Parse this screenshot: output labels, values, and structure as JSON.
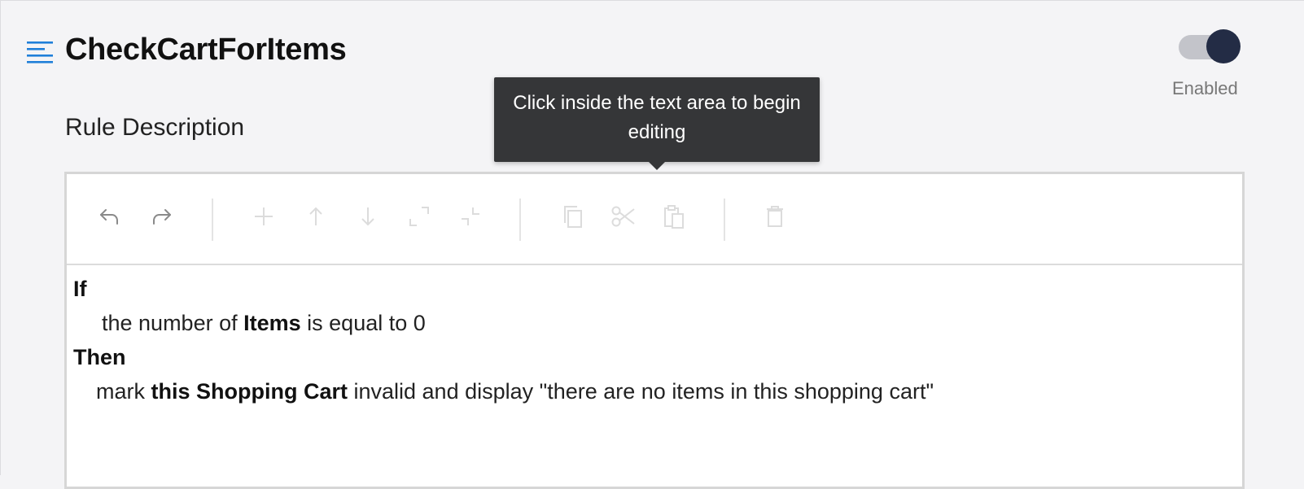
{
  "header": {
    "title": "CheckCartForItems",
    "menu_icon": "hamburger-menu-icon",
    "accent_color": "#1f7fd9"
  },
  "toggle": {
    "state": "on",
    "label": "Enabled",
    "knob_color": "#232c45",
    "track_color": "#c3c4ca"
  },
  "rule": {
    "section_label": "Rule Description",
    "tooltip": "Click inside the text area to begin editing",
    "toolbar": [
      {
        "name": "undo-button",
        "icon": "undo-icon",
        "enabled": true
      },
      {
        "name": "redo-button",
        "icon": "redo-icon",
        "enabled": true
      },
      {
        "name": "add-button",
        "icon": "plus-icon",
        "enabled": false
      },
      {
        "name": "move-up-button",
        "icon": "arrow-up-icon",
        "enabled": false
      },
      {
        "name": "move-down-button",
        "icon": "arrow-down-icon",
        "enabled": false
      },
      {
        "name": "expand-button",
        "icon": "expand-icon",
        "enabled": false
      },
      {
        "name": "collapse-button",
        "icon": "collapse-icon",
        "enabled": false
      },
      {
        "name": "copy-button",
        "icon": "copy-icon",
        "enabled": false
      },
      {
        "name": "cut-button",
        "icon": "scissors-icon",
        "enabled": false
      },
      {
        "name": "paste-button",
        "icon": "clipboard-icon",
        "enabled": false
      },
      {
        "name": "delete-button",
        "icon": "trash-icon",
        "enabled": false
      }
    ],
    "if_keyword": "If",
    "condition": {
      "pre": "the number of ",
      "bold": "Items",
      "post": " is equal to 0"
    },
    "then_keyword": "Then",
    "action": {
      "pre": "mark ",
      "bold": "this Shopping Cart",
      "post": " invalid and display \"there are no items in this shopping cart\""
    }
  }
}
